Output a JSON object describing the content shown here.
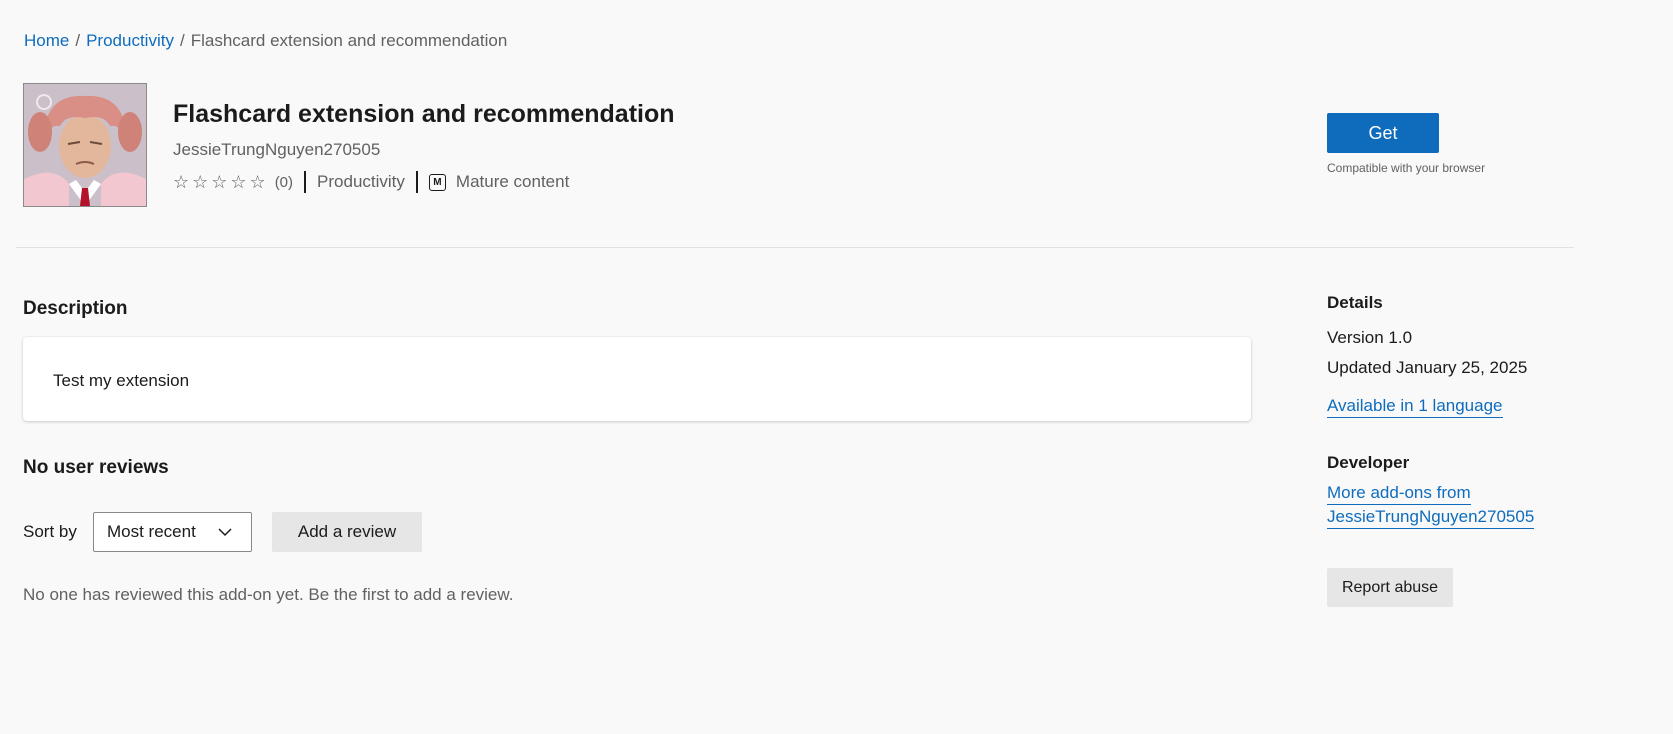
{
  "breadcrumb": {
    "home": "Home",
    "category": "Productivity",
    "current": "Flashcard extension and recommendation",
    "separator": "/"
  },
  "extension": {
    "title": "Flashcard extension and recommendation",
    "developer": "JessieTrungNguyen270505",
    "stars": "☆☆☆☆☆",
    "rating_count": "(0)",
    "category": "Productivity",
    "mature_icon_letter": "M",
    "mature_label": "Mature content",
    "logo_icon": "extension-logo-image"
  },
  "actions": {
    "get_label": "Get",
    "compat_text": "Compatible with your browser"
  },
  "description": {
    "heading": "Description",
    "text": "Test my extension"
  },
  "reviews": {
    "heading": "No user reviews",
    "sort_label": "Sort by",
    "sort_value": "Most recent",
    "add_review_label": "Add a review",
    "empty_text": "No one has reviewed this add-on yet. Be the first to add a review."
  },
  "details": {
    "heading": "Details",
    "version": "Version 1.0",
    "updated": "Updated January 25, 2025",
    "languages_link": "Available in 1 language"
  },
  "developer_section": {
    "heading": "Developer",
    "more_line1": "More add-ons from",
    "more_line2": "JessieTrungNguyen270505",
    "report_label": "Report abuse"
  },
  "colors": {
    "accent": "#0f6cbd",
    "background": "#f9f9f9",
    "secondary_text": "#616161"
  }
}
